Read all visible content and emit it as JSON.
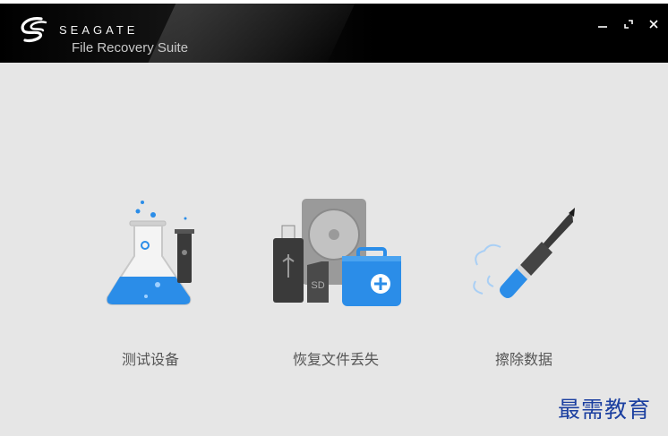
{
  "app": {
    "brand": "SEAGATE",
    "product": "File Recovery Suite"
  },
  "window_controls": {
    "minimize": "minimize",
    "maximize": "maximize",
    "close": "close"
  },
  "options": [
    {
      "label": "测试设备",
      "icon": "flask-icon"
    },
    {
      "label": "恢复文件丢失",
      "icon": "recovery-devices-icon"
    },
    {
      "label": "擦除数据",
      "icon": "eraser-pencil-icon"
    }
  ],
  "watermark": "最需教育",
  "colors": {
    "titlebar": "#000000",
    "background": "#e6e6e6",
    "accent_blue": "#2b8de8",
    "label_gray": "#555555",
    "watermark": "#1b3fa0"
  }
}
